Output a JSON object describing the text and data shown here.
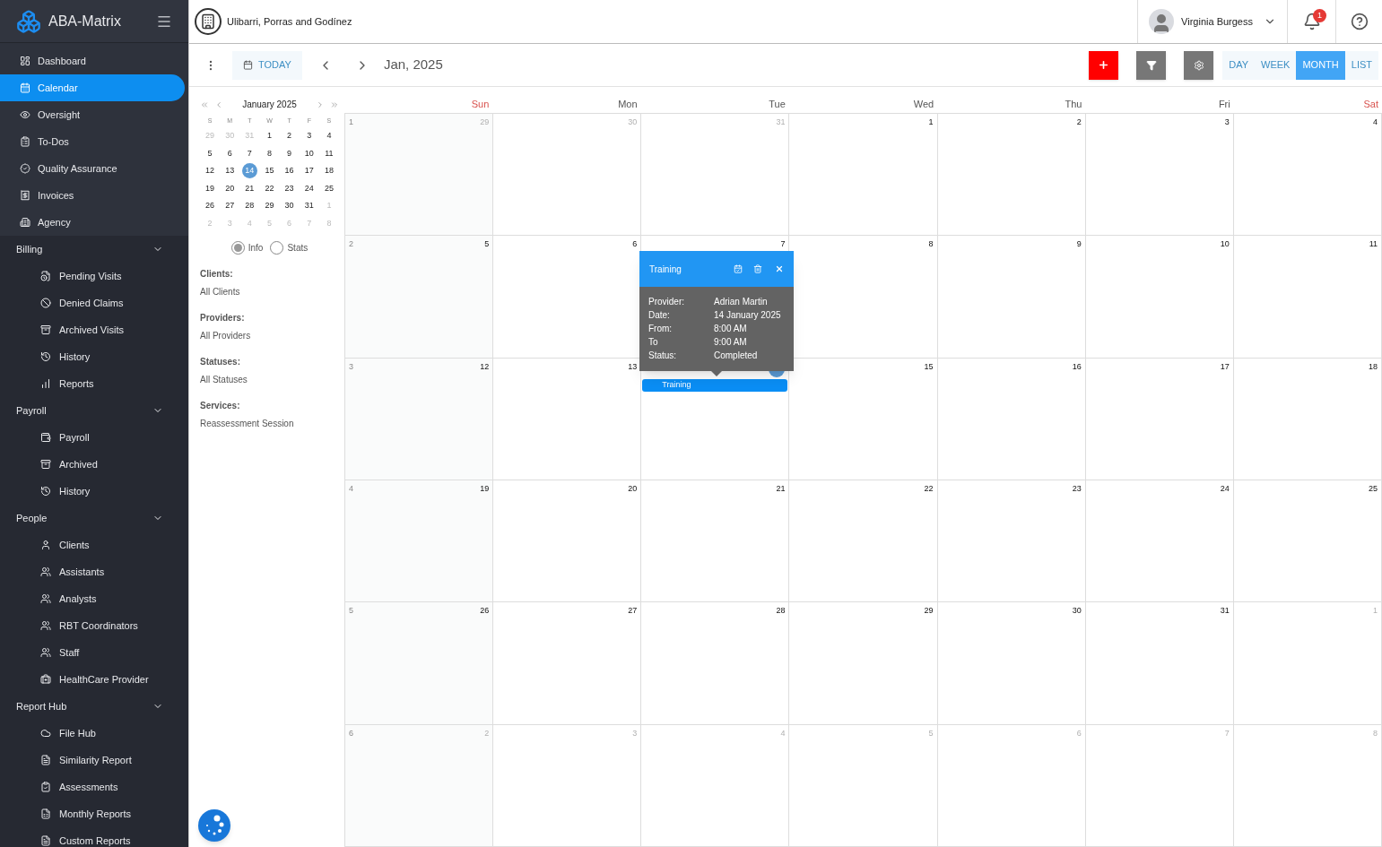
{
  "sidebar": {
    "brand": "ABA-Matrix",
    "items": [
      {
        "label": "Dashboard",
        "selected": false
      },
      {
        "label": "Calendar",
        "selected": true
      },
      {
        "label": "Oversight",
        "selected": false
      },
      {
        "label": "To-Dos",
        "selected": false
      },
      {
        "label": "Quality Assurance",
        "selected": false
      },
      {
        "label": "Invoices",
        "selected": false
      },
      {
        "label": "Agency",
        "selected": false
      }
    ],
    "groups": [
      {
        "label": "Billing",
        "expanded": true,
        "items": [
          "Pending Visits",
          "Denied Claims",
          "Archived Visits",
          "History",
          "Reports"
        ]
      },
      {
        "label": "Payroll",
        "expanded": true,
        "items": [
          "Payroll",
          "Archived",
          "History"
        ]
      },
      {
        "label": "People",
        "expanded": true,
        "items": [
          "Clients",
          "Assistants",
          "Analysts",
          "RBT Coordinators",
          "Staff",
          "HealthCare Provider"
        ]
      },
      {
        "label": "Report Hub",
        "expanded": true,
        "items": [
          "File Hub",
          "Similarity Report",
          "Assessments",
          "Monthly Reports",
          "Custom Reports"
        ]
      }
    ]
  },
  "header": {
    "company": "Ulibarri, Porras and Godínez",
    "user": "Virginia Burgess",
    "notification_count": "1"
  },
  "toolbar": {
    "today": "TODAY",
    "period": "Jan, 2025",
    "views": [
      {
        "label": "DAY",
        "selected": false
      },
      {
        "label": "WEEK",
        "selected": false
      },
      {
        "label": "MONTH",
        "selected": true
      },
      {
        "label": "LIST",
        "selected": false
      }
    ]
  },
  "mini_calendar": {
    "month": "January 2025",
    "weekdays": [
      "S",
      "M",
      "T",
      "W",
      "T",
      "F",
      "S"
    ],
    "weeks": [
      [
        {
          "day": "29",
          "other_month": true,
          "selected": false
        },
        {
          "day": "30",
          "other_month": true,
          "selected": false
        },
        {
          "day": "31",
          "other_month": true,
          "selected": false
        },
        {
          "day": "1",
          "other_month": false,
          "selected": false
        },
        {
          "day": "2",
          "other_month": false,
          "selected": false
        },
        {
          "day": "3",
          "other_month": false,
          "selected": false
        },
        {
          "day": "4",
          "other_month": false,
          "selected": false
        }
      ],
      [
        {
          "day": "5",
          "other_month": false,
          "selected": false
        },
        {
          "day": "6",
          "other_month": false,
          "selected": false
        },
        {
          "day": "7",
          "other_month": false,
          "selected": false
        },
        {
          "day": "8",
          "other_month": false,
          "selected": false
        },
        {
          "day": "9",
          "other_month": false,
          "selected": false
        },
        {
          "day": "10",
          "other_month": false,
          "selected": false
        },
        {
          "day": "11",
          "other_month": false,
          "selected": false
        }
      ],
      [
        {
          "day": "12",
          "other_month": false,
          "selected": false
        },
        {
          "day": "13",
          "other_month": false,
          "selected": false
        },
        {
          "day": "14",
          "other_month": false,
          "selected": true
        },
        {
          "day": "15",
          "other_month": false,
          "selected": false
        },
        {
          "day": "16",
          "other_month": false,
          "selected": false
        },
        {
          "day": "17",
          "other_month": false,
          "selected": false
        },
        {
          "day": "18",
          "other_month": false,
          "selected": false
        }
      ],
      [
        {
          "day": "19",
          "other_month": false,
          "selected": false
        },
        {
          "day": "20",
          "other_month": false,
          "selected": false
        },
        {
          "day": "21",
          "other_month": false,
          "selected": false
        },
        {
          "day": "22",
          "other_month": false,
          "selected": false
        },
        {
          "day": "23",
          "other_month": false,
          "selected": false
        },
        {
          "day": "24",
          "other_month": false,
          "selected": false
        },
        {
          "day": "25",
          "other_month": false,
          "selected": false
        }
      ],
      [
        {
          "day": "26",
          "other_month": false,
          "selected": false
        },
        {
          "day": "27",
          "other_month": false,
          "selected": false
        },
        {
          "day": "28",
          "other_month": false,
          "selected": false
        },
        {
          "day": "29",
          "other_month": false,
          "selected": false
        },
        {
          "day": "30",
          "other_month": false,
          "selected": false
        },
        {
          "day": "31",
          "other_month": false,
          "selected": false
        },
        {
          "day": "1",
          "other_month": true,
          "selected": false
        }
      ],
      [
        {
          "day": "2",
          "other_month": true,
          "selected": false
        },
        {
          "day": "3",
          "other_month": true,
          "selected": false
        },
        {
          "day": "4",
          "other_month": true,
          "selected": false
        },
        {
          "day": "5",
          "other_month": true,
          "selected": false
        },
        {
          "day": "6",
          "other_month": true,
          "selected": false
        },
        {
          "day": "7",
          "other_month": true,
          "selected": false
        },
        {
          "day": "8",
          "other_month": true,
          "selected": false
        }
      ]
    ]
  },
  "display_options": [
    {
      "label": "Info",
      "selected": true
    },
    {
      "label": "Stats",
      "selected": false
    }
  ],
  "filters": [
    {
      "label": "Clients:",
      "value": "All Clients"
    },
    {
      "label": "Providers:",
      "value": "All Providers"
    },
    {
      "label": "Statuses:",
      "value": "All Statuses"
    },
    {
      "label": "Services:",
      "value": "Reassessment Session"
    }
  ],
  "month_view": {
    "weekdays": [
      {
        "label": "Sun",
        "color": "#d9534f"
      },
      {
        "label": "Mon",
        "color": "#555555"
      },
      {
        "label": "Tue",
        "color": "#555555"
      },
      {
        "label": "Wed",
        "color": "#555555"
      },
      {
        "label": "Thu",
        "color": "#555555"
      },
      {
        "label": "Fri",
        "color": "#555555"
      },
      {
        "label": "Sat",
        "color": "#d9534f"
      }
    ],
    "weeks": [
      {
        "number": "1",
        "days": [
          {
            "day": "29",
            "other_month": true
          },
          {
            "day": "30",
            "other_month": true
          },
          {
            "day": "31",
            "other_month": true
          },
          {
            "day": "1",
            "other_month": false
          },
          {
            "day": "2",
            "other_month": false
          },
          {
            "day": "3",
            "other_month": false
          },
          {
            "day": "4",
            "other_month": false
          }
        ]
      },
      {
        "number": "2",
        "days": [
          {
            "day": "5",
            "other_month": false
          },
          {
            "day": "6",
            "other_month": false
          },
          {
            "day": "7",
            "other_month": false
          },
          {
            "day": "8",
            "other_month": false
          },
          {
            "day": "9",
            "other_month": false
          },
          {
            "day": "10",
            "other_month": false
          },
          {
            "day": "11",
            "other_month": false
          }
        ]
      },
      {
        "number": "3",
        "days": [
          {
            "day": "12",
            "other_month": false
          },
          {
            "day": "13",
            "other_month": false
          },
          {
            "today": true,
            "events": [
              "Training"
            ]
          },
          {
            "day": "15",
            "other_month": false
          },
          {
            "day": "16",
            "other_month": false
          },
          {
            "day": "17",
            "other_month": false
          },
          {
            "day": "18",
            "other_month": false
          }
        ]
      },
      {
        "number": "4",
        "days": [
          {
            "day": "19",
            "other_month": false
          },
          {
            "day": "20",
            "other_month": false
          },
          {
            "day": "21",
            "other_month": false
          },
          {
            "day": "22",
            "other_month": false
          },
          {
            "day": "23",
            "other_month": false
          },
          {
            "day": "24",
            "other_month": false
          },
          {
            "day": "25",
            "other_month": false
          }
        ]
      },
      {
        "number": "5",
        "days": [
          {
            "day": "26",
            "other_month": false
          },
          {
            "day": "27",
            "other_month": false
          },
          {
            "day": "28",
            "other_month": false
          },
          {
            "day": "29",
            "other_month": false
          },
          {
            "day": "30",
            "other_month": false
          },
          {
            "day": "31",
            "other_month": false
          },
          {
            "day": "1",
            "other_month": true
          }
        ]
      },
      {
        "number": "6",
        "days": [
          {
            "day": "2",
            "other_month": true
          },
          {
            "day": "3",
            "other_month": true
          },
          {
            "day": "4",
            "other_month": true
          },
          {
            "day": "5",
            "other_month": true
          },
          {
            "day": "6",
            "other_month": true
          },
          {
            "day": "7",
            "other_month": true
          },
          {
            "day": "8",
            "other_month": true
          }
        ]
      }
    ]
  },
  "popup": {
    "title": "Training",
    "rows": [
      {
        "label": "Provider:",
        "value": "Adrian Martin"
      },
      {
        "label": "Date:",
        "value": "14 January 2025"
      },
      {
        "label": "From:",
        "value": "8:00 AM"
      },
      {
        "label": "To",
        "value": "9:00 AM"
      },
      {
        "label": "Status:",
        "value": "Completed"
      }
    ]
  }
}
